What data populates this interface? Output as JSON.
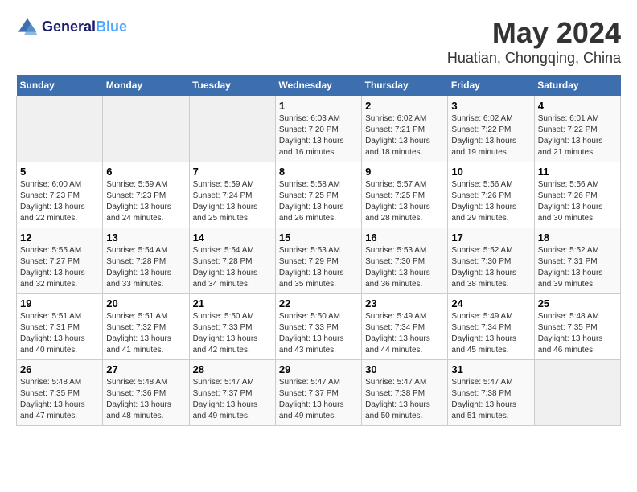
{
  "logo": {
    "line1": "General",
    "line2": "Blue"
  },
  "title": "May 2024",
  "subtitle": "Huatian, Chongqing, China",
  "weekdays": [
    "Sunday",
    "Monday",
    "Tuesday",
    "Wednesday",
    "Thursday",
    "Friday",
    "Saturday"
  ],
  "weeks": [
    [
      {
        "day": "",
        "info": ""
      },
      {
        "day": "",
        "info": ""
      },
      {
        "day": "",
        "info": ""
      },
      {
        "day": "1",
        "info": "Sunrise: 6:03 AM\nSunset: 7:20 PM\nDaylight: 13 hours and 16 minutes."
      },
      {
        "day": "2",
        "info": "Sunrise: 6:02 AM\nSunset: 7:21 PM\nDaylight: 13 hours and 18 minutes."
      },
      {
        "day": "3",
        "info": "Sunrise: 6:02 AM\nSunset: 7:22 PM\nDaylight: 13 hours and 19 minutes."
      },
      {
        "day": "4",
        "info": "Sunrise: 6:01 AM\nSunset: 7:22 PM\nDaylight: 13 hours and 21 minutes."
      }
    ],
    [
      {
        "day": "5",
        "info": "Sunrise: 6:00 AM\nSunset: 7:23 PM\nDaylight: 13 hours and 22 minutes."
      },
      {
        "day": "6",
        "info": "Sunrise: 5:59 AM\nSunset: 7:23 PM\nDaylight: 13 hours and 24 minutes."
      },
      {
        "day": "7",
        "info": "Sunrise: 5:59 AM\nSunset: 7:24 PM\nDaylight: 13 hours and 25 minutes."
      },
      {
        "day": "8",
        "info": "Sunrise: 5:58 AM\nSunset: 7:25 PM\nDaylight: 13 hours and 26 minutes."
      },
      {
        "day": "9",
        "info": "Sunrise: 5:57 AM\nSunset: 7:25 PM\nDaylight: 13 hours and 28 minutes."
      },
      {
        "day": "10",
        "info": "Sunrise: 5:56 AM\nSunset: 7:26 PM\nDaylight: 13 hours and 29 minutes."
      },
      {
        "day": "11",
        "info": "Sunrise: 5:56 AM\nSunset: 7:26 PM\nDaylight: 13 hours and 30 minutes."
      }
    ],
    [
      {
        "day": "12",
        "info": "Sunrise: 5:55 AM\nSunset: 7:27 PM\nDaylight: 13 hours and 32 minutes."
      },
      {
        "day": "13",
        "info": "Sunrise: 5:54 AM\nSunset: 7:28 PM\nDaylight: 13 hours and 33 minutes."
      },
      {
        "day": "14",
        "info": "Sunrise: 5:54 AM\nSunset: 7:28 PM\nDaylight: 13 hours and 34 minutes."
      },
      {
        "day": "15",
        "info": "Sunrise: 5:53 AM\nSunset: 7:29 PM\nDaylight: 13 hours and 35 minutes."
      },
      {
        "day": "16",
        "info": "Sunrise: 5:53 AM\nSunset: 7:30 PM\nDaylight: 13 hours and 36 minutes."
      },
      {
        "day": "17",
        "info": "Sunrise: 5:52 AM\nSunset: 7:30 PM\nDaylight: 13 hours and 38 minutes."
      },
      {
        "day": "18",
        "info": "Sunrise: 5:52 AM\nSunset: 7:31 PM\nDaylight: 13 hours and 39 minutes."
      }
    ],
    [
      {
        "day": "19",
        "info": "Sunrise: 5:51 AM\nSunset: 7:31 PM\nDaylight: 13 hours and 40 minutes."
      },
      {
        "day": "20",
        "info": "Sunrise: 5:51 AM\nSunset: 7:32 PM\nDaylight: 13 hours and 41 minutes."
      },
      {
        "day": "21",
        "info": "Sunrise: 5:50 AM\nSunset: 7:33 PM\nDaylight: 13 hours and 42 minutes."
      },
      {
        "day": "22",
        "info": "Sunrise: 5:50 AM\nSunset: 7:33 PM\nDaylight: 13 hours and 43 minutes."
      },
      {
        "day": "23",
        "info": "Sunrise: 5:49 AM\nSunset: 7:34 PM\nDaylight: 13 hours and 44 minutes."
      },
      {
        "day": "24",
        "info": "Sunrise: 5:49 AM\nSunset: 7:34 PM\nDaylight: 13 hours and 45 minutes."
      },
      {
        "day": "25",
        "info": "Sunrise: 5:48 AM\nSunset: 7:35 PM\nDaylight: 13 hours and 46 minutes."
      }
    ],
    [
      {
        "day": "26",
        "info": "Sunrise: 5:48 AM\nSunset: 7:35 PM\nDaylight: 13 hours and 47 minutes."
      },
      {
        "day": "27",
        "info": "Sunrise: 5:48 AM\nSunset: 7:36 PM\nDaylight: 13 hours and 48 minutes."
      },
      {
        "day": "28",
        "info": "Sunrise: 5:47 AM\nSunset: 7:37 PM\nDaylight: 13 hours and 49 minutes."
      },
      {
        "day": "29",
        "info": "Sunrise: 5:47 AM\nSunset: 7:37 PM\nDaylight: 13 hours and 49 minutes."
      },
      {
        "day": "30",
        "info": "Sunrise: 5:47 AM\nSunset: 7:38 PM\nDaylight: 13 hours and 50 minutes."
      },
      {
        "day": "31",
        "info": "Sunrise: 5:47 AM\nSunset: 7:38 PM\nDaylight: 13 hours and 51 minutes."
      },
      {
        "day": "",
        "info": ""
      }
    ]
  ]
}
